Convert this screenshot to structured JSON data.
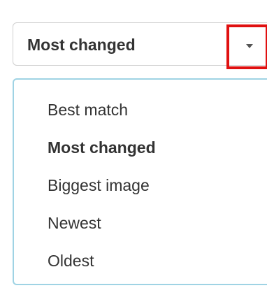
{
  "sort": {
    "selected_label": "Most changed",
    "toggle_icon": "caret-down-icon",
    "highlight_color": "#e01010",
    "menu_border_color": "#9fd3e4",
    "options": [
      {
        "label": "Best match",
        "selected": false
      },
      {
        "label": "Most changed",
        "selected": true
      },
      {
        "label": "Biggest image",
        "selected": false
      },
      {
        "label": "Newest",
        "selected": false
      },
      {
        "label": "Oldest",
        "selected": false
      }
    ]
  }
}
